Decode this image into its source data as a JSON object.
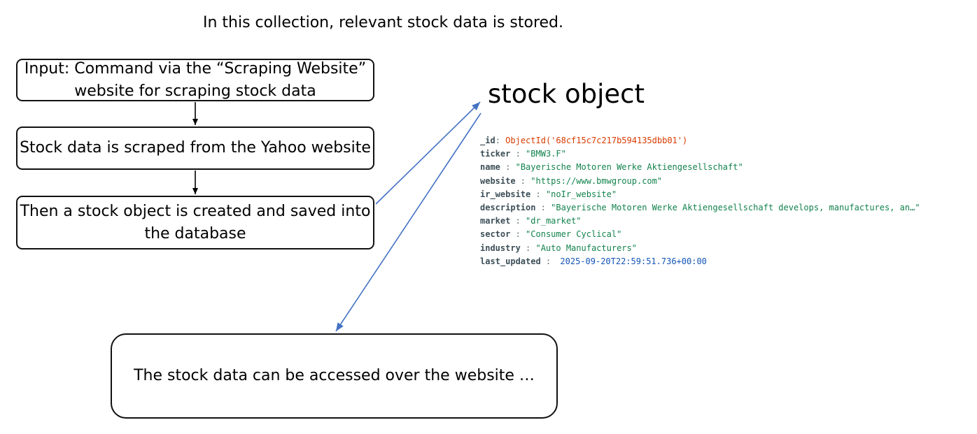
{
  "header_note": "In this collection, relevant stock data is stored.",
  "flow": {
    "steps": [
      "Input: Command via the “Scraping Website” website for scraping stock data",
      "Stock data is scraped from the Yahoo website",
      "Then a stock object is created and saved into the database"
    ],
    "access_note": "The stock data can be accessed over the website …"
  },
  "stock_object": {
    "title": "stock object",
    "fields": [
      {
        "key": "_id",
        "sep": ": ",
        "value": "ObjectId('68cf15c7c217b594135dbb01')",
        "kind": "oid"
      },
      {
        "key": "ticker",
        "sep": " : ",
        "value": "\"BMW3.F\"",
        "kind": "str"
      },
      {
        "key": "name",
        "sep": " : ",
        "value": "\"Bayerische Motoren Werke Aktiengesellschaft\"",
        "kind": "str"
      },
      {
        "key": "website",
        "sep": " : ",
        "value": "\"https://www.bmwgroup.com\"",
        "kind": "str"
      },
      {
        "key": "ir_website",
        "sep": " : ",
        "value": "\"noIr_website\"",
        "kind": "str"
      },
      {
        "key": "description",
        "sep": " : ",
        "value": "\"Bayerische Motoren Werke Aktiengesellschaft develops, manufactures, an…\"",
        "kind": "str"
      },
      {
        "key": "market",
        "sep": " : ",
        "value": "\"dr_market\"",
        "kind": "str"
      },
      {
        "key": "sector",
        "sep": " : ",
        "value": "\"Consumer Cyclical\"",
        "kind": "str"
      },
      {
        "key": "industry",
        "sep": " : ",
        "value": "\"Auto Manufacturers\"",
        "kind": "str"
      },
      {
        "key": "last_updated",
        "sep": " : ",
        "value": "2025-09-20T22:59:51.736+00:00",
        "kind": "date"
      }
    ]
  },
  "colors": {
    "arrow_blue": "#4472c4",
    "arrow_black": "#000000",
    "key": "#3d4f58",
    "string_value": "#12824c",
    "object_id": "#d83b01",
    "date_value": "#1254b7"
  }
}
